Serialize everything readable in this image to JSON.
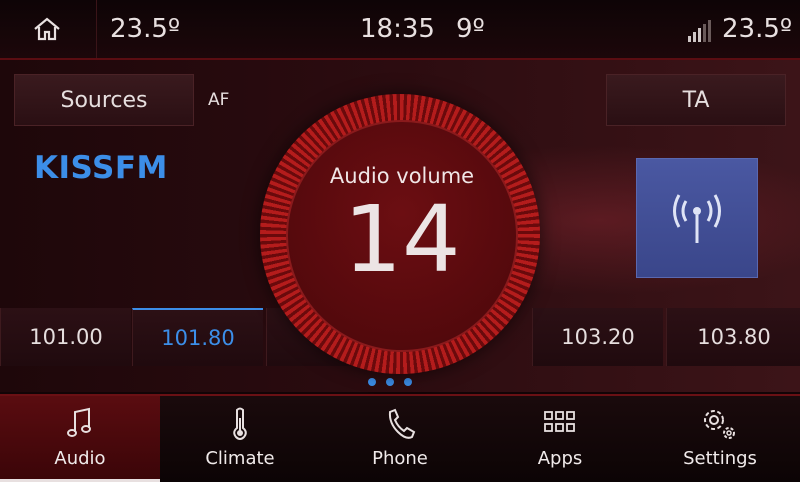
{
  "status": {
    "temp_left": "23.5º",
    "time": "18:35",
    "outside_temp": "9º",
    "temp_right": "23.5º"
  },
  "audio": {
    "sources_label": "Sources",
    "af_label": "AF",
    "ta_label": "TA",
    "station_name": "KISSFM",
    "presets": [
      "101.00",
      "101.80",
      "103.20",
      "103.80"
    ],
    "active_preset": "101.80"
  },
  "volume": {
    "label": "Audio volume",
    "value": "14"
  },
  "nav": {
    "items": [
      {
        "label": "Audio",
        "icon": "music-note-icon"
      },
      {
        "label": "Climate",
        "icon": "thermometer-icon"
      },
      {
        "label": "Phone",
        "icon": "phone-icon"
      },
      {
        "label": "Apps",
        "icon": "apps-grid-icon"
      },
      {
        "label": "Settings",
        "icon": "gear-icon"
      }
    ],
    "active": "Audio"
  },
  "colors": {
    "accent_blue": "#3c8ee8",
    "volume_red": "#b41c1c",
    "radio_tile": "#4a58a2"
  }
}
